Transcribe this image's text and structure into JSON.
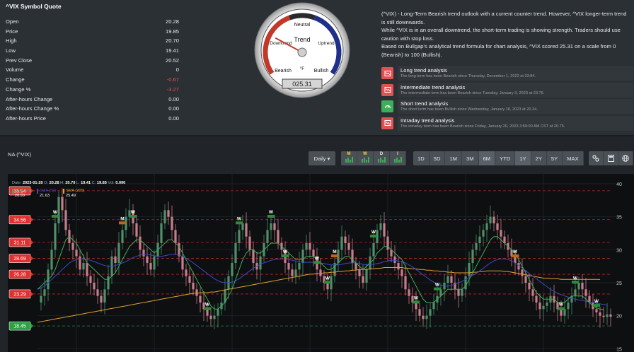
{
  "quote": {
    "title": "^VIX Symbol Quote",
    "rows": [
      {
        "label": "Open",
        "value": "20.28",
        "negative": false
      },
      {
        "label": "Price",
        "value": "19.85",
        "negative": false
      },
      {
        "label": "High",
        "value": "20.70",
        "negative": false
      },
      {
        "label": "Low",
        "value": "19.41",
        "negative": false
      },
      {
        "label": "Prev Close",
        "value": "20.52",
        "negative": false
      },
      {
        "label": "Volume",
        "value": "0",
        "negative": false
      },
      {
        "label": "Change",
        "value": "-0.67",
        "negative": true
      },
      {
        "label": "Change %",
        "value": "-3.27",
        "negative": true
      },
      {
        "label": "After-hours Change",
        "value": "0.00",
        "negative": false
      },
      {
        "label": "After-hours Change %",
        "value": "0.00",
        "negative": false
      },
      {
        "label": "After-hours Price",
        "value": "0.00",
        "negative": false
      }
    ]
  },
  "gauge": {
    "title": "Trend",
    "labels": {
      "neutral": "Neutral",
      "downtrend": "Downtrend",
      "uptrend": "Uptrend",
      "bearish": "Bearish",
      "bullish": "Bullish",
      "unit": "°F"
    },
    "reading": "025.31",
    "score": 25.31,
    "colors": {
      "bear": "#c0392b",
      "bull": "#1f2f8a",
      "neutral": "#2a2a2a"
    }
  },
  "analysis": {
    "paragraphs": [
      "(^VIX) - Long-Term Bearish trend outlook with a current counter trend. However, ^VIX longer-term trend is still downwards.",
      "While ^VIX is in an overall downtrend, the short-term trading is showing strength. Traders should use caution with stop loss.",
      "Based on Bullgap's analytical trend formula for chart analysis, ^VIX scored 25.31 on a scale from 0 (Bearish) to 100 (Bullish)."
    ]
  },
  "trends": [
    {
      "name": "Long trend analysis",
      "desc": "The long term has been Bearish since Thursday, December 1, 2022 at 23:84.",
      "kind": "bear",
      "icon": "bear-chart-icon"
    },
    {
      "name": "Intermediate trend analysis",
      "desc": "The intermediate term has been Bearish since Tuesday, January 3, 2023 at 23.76.",
      "kind": "bear",
      "icon": "bear-chart-icon"
    },
    {
      "name": "Short trend analysis",
      "desc": "The short term has been Bullish since Wednesday, January 18, 2023 at 20.34.",
      "kind": "bull",
      "icon": "bull-gauge-icon"
    },
    {
      "name": "Intraday trend analysis",
      "desc": "The intraday term has been Bearish since Friday, January 20, 2023 3:50:00 AM CST at 20.75.",
      "kind": "bear",
      "icon": "bear-chart-icon"
    }
  ],
  "toolbar": {
    "symbol": "NA (^VIX)",
    "interval": "Daily ▾",
    "chart_types": [
      "M",
      "W",
      "D",
      "I"
    ],
    "ranges": [
      "1D",
      "5D",
      "1M",
      "3M",
      "6M",
      "YTD",
      "1Y",
      "2Y",
      "5Y",
      "MAX"
    ],
    "active_ranges": [
      "6M",
      "1Y"
    ],
    "tools": [
      "settings-icon",
      "calculator-icon",
      "globe-icon"
    ]
  },
  "ohlc": {
    "date_label": "Date:",
    "date": "2023-01-20",
    "o_label": "O:",
    "o": "20.28",
    "h_label": "H:",
    "h": "20.70",
    "l_label": "L:",
    "l": "19.41",
    "c_label": "C:",
    "c": "19.85",
    "v_label": "Vol:",
    "v": "0.000"
  },
  "sma": [
    {
      "name": "SMA (20)",
      "value": "20.93",
      "color": "#3fae5a"
    },
    {
      "name": "SMA (50)",
      "value": "21.63",
      "color": "#3b4cc0"
    },
    {
      "name": "SMA (200)",
      "value": "25.49",
      "color": "#e0a030"
    }
  ],
  "chart_data": {
    "type": "line",
    "y_ticks": [
      15,
      20,
      25,
      30,
      35,
      40
    ],
    "ylim": [
      14.5,
      41.5
    ],
    "grid": true,
    "levels": [
      {
        "value": "38.94",
        "kind": "resistance"
      },
      {
        "value": "34.56",
        "kind": "resistance"
      },
      {
        "value": "31.11",
        "kind": "resistance"
      },
      {
        "value": "28.69",
        "kind": "resistance"
      },
      {
        "value": "26.28",
        "kind": "resistance"
      },
      {
        "value": "23.29",
        "kind": "resistance"
      },
      {
        "value": "18.45",
        "kind": "support"
      }
    ],
    "price": [
      22,
      23,
      24,
      27,
      30,
      34,
      38,
      36,
      33,
      31,
      30,
      29,
      27,
      28,
      26,
      25,
      24,
      23,
      22,
      24,
      26,
      29,
      28,
      31,
      33,
      35,
      36,
      34,
      32,
      30,
      29,
      28,
      27,
      29,
      31,
      34,
      36,
      35,
      33,
      31,
      29,
      27,
      26,
      25,
      24,
      23,
      22,
      21,
      20,
      19.5,
      20,
      21,
      22,
      24,
      26,
      28,
      31,
      33,
      34,
      32,
      30,
      28,
      27,
      29,
      31,
      33,
      34,
      33,
      31,
      30,
      28,
      27,
      26,
      27,
      28,
      30,
      31,
      30,
      29,
      27,
      26,
      25,
      24,
      26,
      28,
      30,
      32,
      31,
      30,
      28,
      27,
      26,
      25,
      27,
      29,
      31,
      33,
      34,
      32,
      30,
      29,
      28,
      27,
      26,
      24,
      23,
      22,
      21,
      20,
      19.5,
      20,
      21,
      22,
      23,
      24,
      25,
      26,
      25,
      24,
      23,
      24,
      26,
      28,
      30,
      31,
      32,
      33,
      34,
      35,
      34,
      33,
      32,
      31,
      30,
      29,
      28,
      27,
      26,
      25,
      24,
      23,
      22,
      21,
      21.5,
      22,
      23,
      22,
      21,
      20,
      21,
      22,
      23,
      24,
      25,
      24,
      23,
      22,
      21,
      20.5,
      20,
      19.8,
      20.2,
      19.85
    ],
    "sma20": [
      24,
      24.5,
      25,
      25.5,
      26,
      27,
      28.5,
      30,
      31.5,
      32,
      31.5,
      31,
      30,
      29,
      28,
      27.5,
      27,
      26.5,
      26,
      25.5,
      25.5,
      26,
      26.5,
      27.5,
      28.5,
      29.5,
      30.5,
      31,
      31.5,
      31.5,
      31,
      30.5,
      30,
      29.5,
      30,
      30.5,
      31,
      31.5,
      31.5,
      31,
      30.5,
      29.5,
      28.5,
      27.5,
      26.5,
      25.5,
      24.5,
      23.5,
      22.5,
      21.5,
      21,
      21,
      21.5,
      22,
      23,
      24,
      25.5,
      27,
      28.5,
      29.5,
      30,
      30,
      29.5,
      29.5,
      30,
      30.5,
      31,
      31,
      31,
      30.5,
      30,
      29.5,
      29,
      28.5,
      28.5,
      28.5,
      29,
      29,
      29,
      28.5,
      28,
      27.5,
      27,
      27,
      27.5,
      28,
      28.5,
      29,
      29,
      28.5,
      28,
      27.5,
      27,
      27.5,
      28,
      28.5,
      29.5,
      30,
      30.5,
      30.5,
      30,
      29.5,
      29,
      28.5,
      27.5,
      26.5,
      25.5,
      24.5,
      23.5,
      22.5,
      22,
      22,
      22,
      22.5,
      23,
      23.5,
      24,
      24,
      24,
      24,
      24,
      24.5,
      25.5,
      26.5,
      27.5,
      28.5,
      29.5,
      30.5,
      31.5,
      32,
      32,
      31.5,
      31,
      30.5,
      30,
      29.5,
      28.5,
      27.5,
      26.5,
      25.5,
      24.5,
      23.5,
      23,
      22.5,
      22.5,
      22.5,
      22.5,
      22,
      22,
      22,
      22.5,
      23,
      23,
      23,
      23,
      22.5,
      22,
      21.5,
      21.2,
      21,
      20.93
    ],
    "sma50": [
      24,
      24.2,
      24.5,
      25,
      25.5,
      26,
      26.5,
      27,
      27.5,
      28,
      28.3,
      28.5,
      28.6,
      28.6,
      28.5,
      28.4,
      28.2,
      28,
      27.8,
      27.6,
      27.5,
      27.5,
      27.6,
      27.8,
      28,
      28.2,
      28.5,
      28.8,
      29,
      29.2,
      29.3,
      29.3,
      29.2,
      29.1,
      29,
      29,
      29.1,
      29.2,
      29.3,
      29.3,
      29.2,
      29,
      28.7,
      28.4,
      28,
      27.6,
      27.2,
      26.8,
      26.4,
      26,
      25.6,
      25.3,
      25.1,
      25,
      25,
      25.1,
      25.3,
      25.6,
      26,
      26.4,
      26.8,
      27.2,
      27.5,
      27.8,
      28,
      28.2,
      28.4,
      28.5,
      28.6,
      28.6,
      28.6,
      28.5,
      28.4,
      28.3,
      28.2,
      28.1,
      28.1,
      28.1,
      28.1,
      28.1,
      28,
      27.9,
      27.8,
      27.7,
      27.7,
      27.7,
      27.8,
      27.9,
      28,
      28,
      28,
      27.9,
      27.8,
      27.7,
      27.7,
      27.8,
      27.9,
      28,
      28.2,
      28.3,
      28.4,
      28.4,
      28.3,
      28.2,
      28,
      27.7,
      27.4,
      27,
      26.6,
      26.2,
      25.8,
      25.4,
      25.1,
      24.8,
      24.6,
      24.5,
      24.5,
      24.6,
      24.8,
      25,
      25.2,
      25.5,
      25.8,
      26.1,
      26.4,
      26.8,
      27.2,
      27.6,
      28,
      28.3,
      28.5,
      28.6,
      28.6,
      28.5,
      28.3,
      28,
      27.6,
      27.2,
      26.8,
      26.4,
      26,
      25.6,
      25.2,
      24.8,
      24.4,
      24,
      23.7,
      23.4,
      23.2,
      23,
      22.8,
      22.6,
      22.5,
      22.4,
      22.3,
      22.2,
      22.1,
      22,
      21.9,
      21.8,
      21.7,
      21.63
    ],
    "sma200": [
      19,
      19.1,
      19.2,
      19.3,
      19.4,
      19.5,
      19.6,
      19.7,
      19.8,
      19.9,
      20,
      20.1,
      20.2,
      20.3,
      20.4,
      20.5,
      20.6,
      20.7,
      20.8,
      20.9,
      21,
      21.1,
      21.2,
      21.3,
      21.4,
      21.5,
      21.6,
      21.7,
      21.8,
      21.9,
      22,
      22.1,
      22.2,
      22.3,
      22.4,
      22.5,
      22.6,
      22.7,
      22.8,
      22.9,
      23,
      23.1,
      23.2,
      23.3,
      23.4,
      23.4,
      23.5,
      23.5,
      23.5,
      23.6,
      23.6,
      23.7,
      23.8,
      23.9,
      24,
      24.1,
      24.2,
      24.3,
      24.4,
      24.5,
      24.6,
      24.7,
      24.8,
      24.9,
      25,
      25.1,
      25.2,
      25.3,
      25.4,
      25.5,
      25.6,
      25.7,
      25.8,
      25.9,
      26,
      26.1,
      26.2,
      26.3,
      26.3,
      26.4,
      26.4,
      26.5,
      26.5,
      26.6,
      26.6,
      26.7,
      26.7,
      26.8,
      26.8,
      26.9,
      26.9,
      27,
      27,
      27,
      27.1,
      27.1,
      27.2,
      27.2,
      27.3,
      27.3,
      27.3,
      27.3,
      27.3,
      27.3,
      27.2,
      27.2,
      27.1,
      27.1,
      27,
      27,
      26.9,
      26.9,
      26.8,
      26.8,
      26.7,
      26.7,
      26.6,
      26.6,
      26.5,
      26.5,
      26.5,
      26.5,
      26.5,
      26.6,
      26.6,
      26.7,
      26.7,
      26.8,
      26.8,
      26.8,
      26.8,
      26.8,
      26.7,
      26.7,
      26.6,
      26.5,
      26.4,
      26.3,
      26.2,
      26.1,
      26,
      25.9,
      25.8,
      25.7,
      25.7,
      25.6,
      25.6,
      25.6,
      25.5,
      25.5,
      25.5,
      25.5,
      25.5,
      25.5,
      25.5,
      25.5,
      25.5,
      25.5,
      25.5,
      25.49
    ],
    "markers": [
      {
        "i": 5,
        "label": "W"
      },
      {
        "i": 24,
        "label": "M"
      },
      {
        "i": 27,
        "label": "W"
      },
      {
        "i": 48,
        "label": "W"
      },
      {
        "i": 57,
        "label": "W"
      },
      {
        "i": 66,
        "label": "W"
      },
      {
        "i": 70,
        "label": "W"
      },
      {
        "i": 79,
        "label": "W"
      },
      {
        "i": 82,
        "label": "W"
      },
      {
        "i": 84,
        "label": "M"
      },
      {
        "i": 95,
        "label": "W"
      },
      {
        "i": 107,
        "label": "W"
      },
      {
        "i": 113,
        "label": "W"
      },
      {
        "i": 135,
        "label": "M"
      },
      {
        "i": 148,
        "label": "W"
      },
      {
        "i": 152,
        "label": "W"
      },
      {
        "i": 158,
        "label": "W"
      }
    ]
  }
}
